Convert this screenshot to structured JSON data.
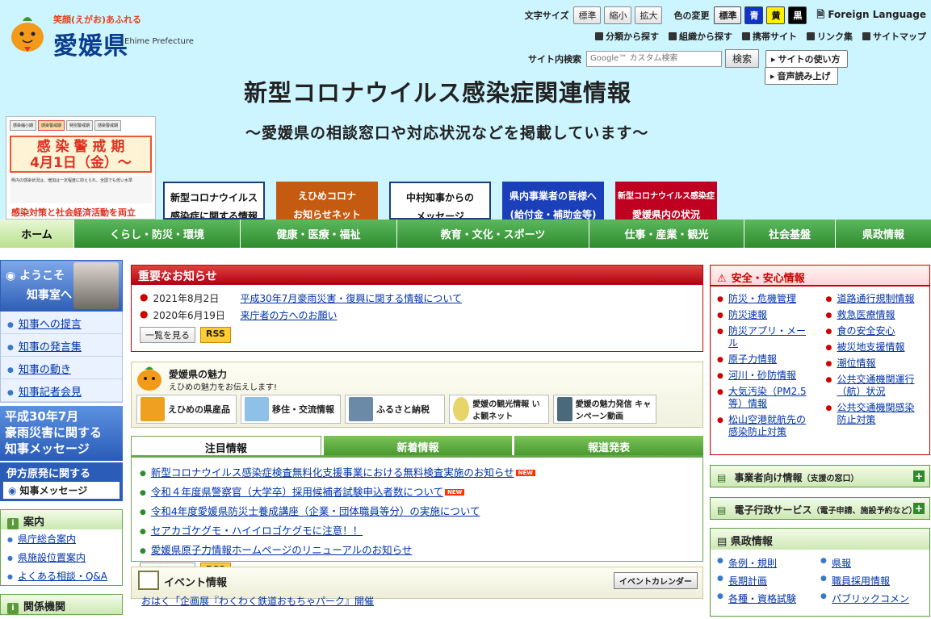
{
  "header": {
    "tagline": "笑顔(えがお)あふれる",
    "pref_name": "愛媛県",
    "pref_en": "Ehime Prefecture",
    "font_size_label": "文字サイズ",
    "font_sizes": [
      "標準",
      "縮小",
      "拡大"
    ],
    "color_label": "色の変更",
    "colors": [
      "標準",
      "青",
      "黄",
      "黒"
    ],
    "foreign": "Foreign Language",
    "links": [
      "分類から探す",
      "組織から探す",
      "携帯サイト",
      "リンク集",
      "サイトマップ"
    ],
    "search_label": "サイト内検索",
    "search_placeholder": "Google™ カスタム検索",
    "search_button": "検索",
    "how_to_use": "サイトの使い方",
    "read_aloud": "音声読み上げ"
  },
  "hero": {
    "title": "新型コロナウイルス感染症関連情報",
    "subtitle": "～愛媛県の相談窓口や対応状況などを掲載しています～"
  },
  "alert": {
    "tabs": [
      "感染縮小期",
      "感染警戒期",
      "特別警戒期",
      "感染警戒期"
    ],
    "main": "感 染 警 戒 期",
    "date": "4月1日（金）～",
    "bullets": "県内の感染状況は、増加は一定程度に抑えられ、全国でも低い水準",
    "bottom": "感染対策と社会経済活動を両立"
  },
  "banners": [
    {
      "l1": "新型コロナウイルス",
      "l2": "感染症に関する情報"
    },
    {
      "l1": "えひめコロナ",
      "l2": "お知らせネット"
    },
    {
      "l1": "中村知事からの",
      "l2": "メッセージ"
    },
    {
      "l1": "県内事業者の皆様へ",
      "l2": "(給付金・補助金等)"
    },
    {
      "l1": "新型コロナウイルス感染症",
      "l2": "愛媛県内の状況"
    }
  ],
  "nav": [
    "ホーム",
    "くらし・防災・環境",
    "健康・医療・福祉",
    "教育・文化・スポーツ",
    "仕事・産業・観光",
    "社会基盤",
    "県政情報"
  ],
  "left": {
    "welcome1": "ようこそ",
    "welcome2": "知事室へ",
    "gov_links": [
      "知事への提言",
      "知事の発言集",
      "知事の動き",
      "知事記者会見"
    ],
    "disaster1": "平成30年7月",
    "disaster2": "豪雨災害に関する",
    "disaster3": "知事メッセージ",
    "ikata_title": "伊方原発に関する",
    "ikata_btn": "知事メッセージ",
    "guide_title": "案内",
    "guide_items": [
      "県庁総合案内",
      "県施設位置案内",
      "よくある相談・Q&A"
    ],
    "related_title": "関係機関"
  },
  "important": {
    "title": "重要なお知らせ",
    "items": [
      {
        "date": "2021年8月2日",
        "text": "平成30年7月豪雨災害・復興に関する情報について"
      },
      {
        "date": "2020年6月19日",
        "text": "来庁者の方へのお願い"
      }
    ],
    "list_btn": "一覧を見る",
    "rss": "RSS"
  },
  "miryoku": {
    "title": "愛媛県の魅力",
    "sub": "えひめの魅力をお伝えします!",
    "tiles": [
      "えひめの県産品",
      "移住・交流情報",
      "ふるさと納税",
      "愛媛の観光情報 いよ観ネット",
      "愛媛の魅力発信 キャンペーン動画"
    ]
  },
  "tabs": [
    "注目情報",
    "新着情報",
    "報道発表"
  ],
  "topics": [
    {
      "text": "新型コロナウイルス感染症検査無料化支援事業における無料検査実施のお知らせ",
      "new": true
    },
    {
      "text": "令和４年度県警察官（大学卒）採用候補者試験申込者数について",
      "new": true
    },
    {
      "text": "令和4年度愛媛県防災士養成講座（企業・団体職員等分）の実施について",
      "new": false
    },
    {
      "text": "セアカゴケグモ・ハイイロゴケグモに注意！！",
      "new": false
    },
    {
      "text": "愛媛県原子力情報ホームページのリニューアルのお知らせ",
      "new": false
    }
  ],
  "new_tag": "NEW",
  "event": {
    "title": "イベント情報",
    "cal_btn": "イベントカレンダー",
    "peek": "おはく「企画展『わくわく鉄道おもちゃパーク』開催"
  },
  "anzen": {
    "title": "安全・安心情報",
    "col1": [
      "防災・危機管理",
      "防災速報",
      "防災アプリ・メール",
      "原子力情報",
      "河川・砂防情報",
      "大気汚染（PM2.5等）情報",
      "松山空港就航先の感染防止対策"
    ],
    "col2": [
      "道路通行規制情報",
      "救急医療情報",
      "食の安全安心",
      "被災地支援情報",
      "潮位情報",
      "公共交通機関運行（航）状況",
      "公共交通機関感染防止対策"
    ]
  },
  "right_bars": [
    {
      "label": "事業者向け情報",
      "small": "（支援の窓口）"
    },
    {
      "label": "電子行政サービス",
      "small": "（電子申請、施設予約など）"
    }
  ],
  "kensei": {
    "title": "県政情報",
    "col1": [
      "条例・規則",
      "長期計画",
      "各種・資格試験"
    ],
    "col2": [
      "県報",
      "職員採用情報",
      "パブリックコメン"
    ]
  }
}
